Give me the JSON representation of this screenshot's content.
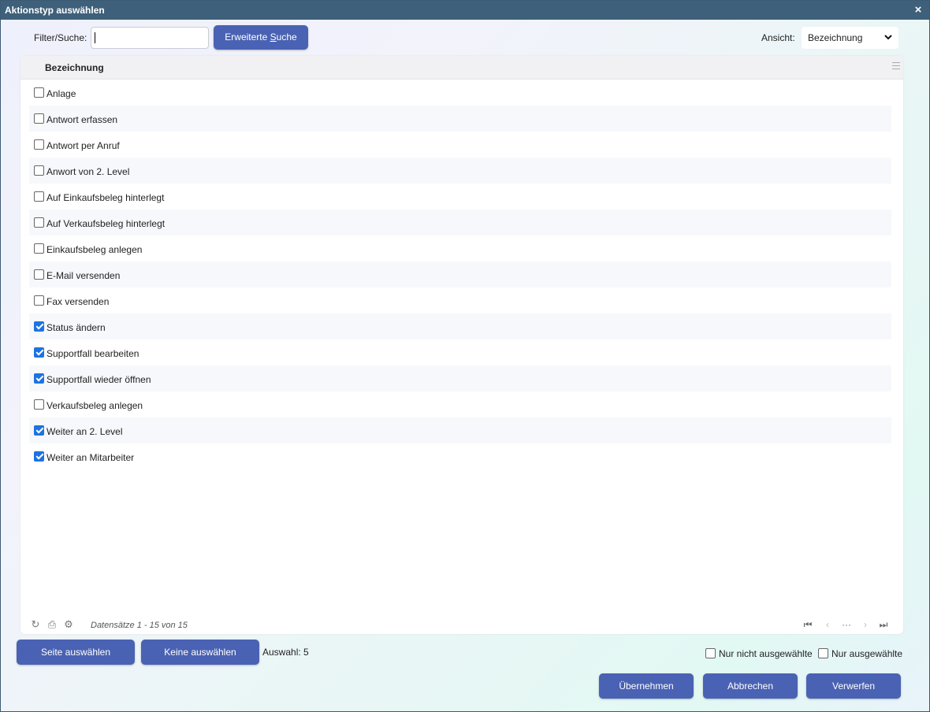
{
  "window": {
    "title": "Aktionstyp auswählen",
    "close_icon": "×"
  },
  "toolbar": {
    "filter_label": "Filter/Suche:",
    "search_value": "",
    "advanced_search_prefix": "Erweiterte ",
    "advanced_search_hotkey": "S",
    "advanced_search_suffix": "uche",
    "view_label": "Ansicht:",
    "view_value": "Bezeichnung"
  },
  "grid": {
    "column_header": "Bezeichnung",
    "rows": [
      {
        "label": "Anlage",
        "checked": false
      },
      {
        "label": "Antwort erfassen",
        "checked": false
      },
      {
        "label": "Antwort per Anruf",
        "checked": false
      },
      {
        "label": "Anwort von 2. Level",
        "checked": false
      },
      {
        "label": "Auf Einkaufsbeleg hinterlegt",
        "checked": false
      },
      {
        "label": "Auf Verkaufsbeleg hinterlegt",
        "checked": false
      },
      {
        "label": "Einkaufsbeleg anlegen",
        "checked": false
      },
      {
        "label": "E-Mail versenden",
        "checked": false
      },
      {
        "label": "Fax versenden",
        "checked": false
      },
      {
        "label": "Status ändern",
        "checked": true
      },
      {
        "label": "Supportfall bearbeiten",
        "checked": true
      },
      {
        "label": "Supportfall wieder öffnen",
        "checked": true
      },
      {
        "label": "Verkaufsbeleg anlegen",
        "checked": false
      },
      {
        "label": "Weiter an 2. Level",
        "checked": true
      },
      {
        "label": "Weiter an Mitarbeiter",
        "checked": true
      }
    ],
    "records_text": "Datensätze 1 - 15 von 15",
    "pager": {
      "first": "⏮",
      "prev": "‹",
      "more": "···",
      "next": "›",
      "last": "⏭"
    },
    "footer_icons": {
      "refresh": "↻",
      "print": "⎙",
      "settings": "⚙"
    }
  },
  "selection": {
    "select_page_label": "Seite auswählen",
    "select_none_label": "Keine auswählen",
    "count_text": "Auswahl: 5",
    "only_unselected_label": "Nur nicht ausgewählte",
    "only_selected_label": "Nur ausgewählte"
  },
  "actions": {
    "apply_label": "Übernehmen",
    "cancel_label": "Abbrechen",
    "discard_label": "Verwerfen"
  },
  "colors": {
    "titlebar": "#3e607a",
    "button": "#4a62b3",
    "checkbox_checked": "#1d73e0"
  }
}
